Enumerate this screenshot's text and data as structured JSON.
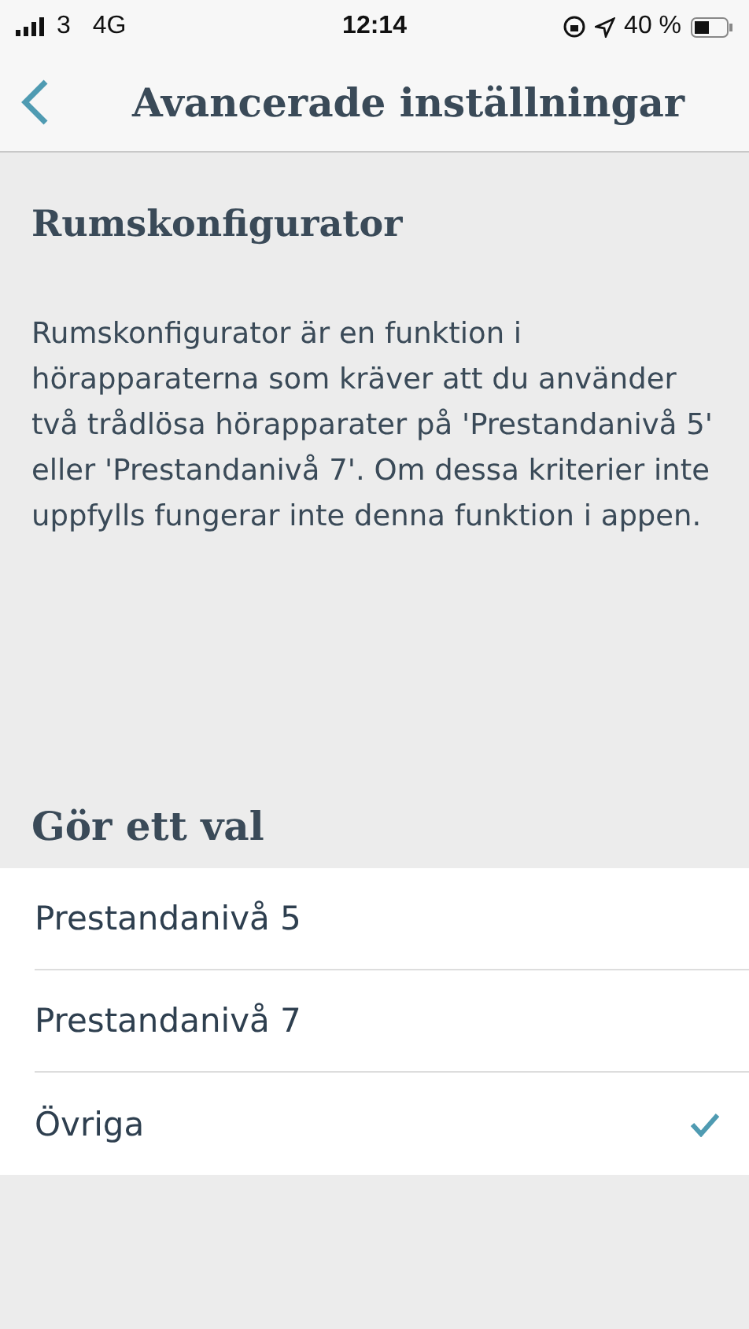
{
  "status_bar": {
    "carrier": "3",
    "network": "4G",
    "time": "12:14",
    "battery": "40 %"
  },
  "nav": {
    "title": "Avancerade inställningar"
  },
  "section": {
    "title": "Rumskonfigurator",
    "description": "Rumskonfigurator är en funktion i hörapparaterna som kräver att du använder två trådlösa hörapparater på 'Prestandanivå 5' eller 'Prestandanivå 7'. Om dessa kriterier inte uppfylls fungerar inte denna funktion i appen."
  },
  "choice": {
    "title": "Gör ett val",
    "options": [
      {
        "label": "Prestandanivå 5",
        "selected": false
      },
      {
        "label": "Prestandanivå 7",
        "selected": false
      },
      {
        "label": "Övriga",
        "selected": true
      }
    ]
  }
}
